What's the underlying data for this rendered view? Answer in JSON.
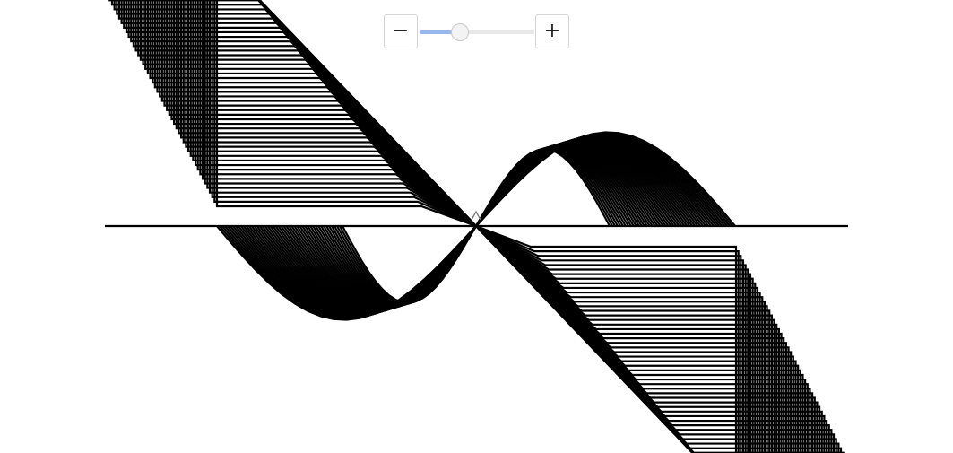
{
  "zoom": {
    "decrease_label": "−",
    "increase_label": "+",
    "slider_level": 0.35
  },
  "artwork": {
    "stroke_color": "#000000",
    "background_color": "#ffffff",
    "line_count": 48,
    "accent_color": "#97b9ef"
  }
}
